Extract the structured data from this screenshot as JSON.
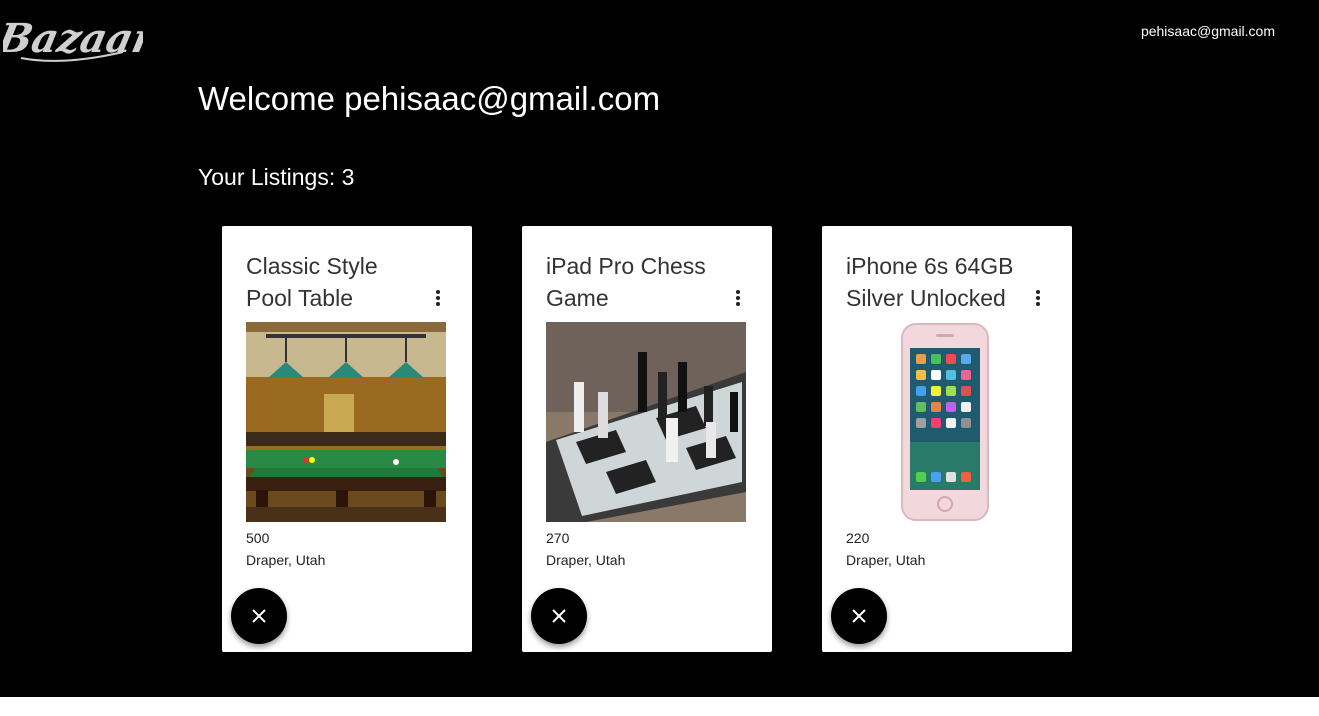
{
  "header": {
    "logo_text": "Bazaar!",
    "user_email": "pehisaac@gmail.com"
  },
  "main": {
    "welcome_text": "Welcome pehisaac@gmail.com",
    "listings_label": "Your Listings: 3"
  },
  "listings": [
    {
      "title": "Classic Style Pool Table",
      "price": "500",
      "location": "Draper, Utah",
      "image": "pool-table-photo"
    },
    {
      "title": "iPad Pro Chess Game",
      "price": "270",
      "location": "Draper, Utah",
      "image": "chess-ipad-photo"
    },
    {
      "title": "iPhone 6s 64GB Silver Unlocked",
      "price": "220",
      "location": "Draper, Utah",
      "image": "iphone-photo"
    }
  ],
  "icons": {
    "menu": "more-vert-icon",
    "delete": "close-icon"
  },
  "colors": {
    "background": "#000000",
    "card": "#ffffff",
    "delete_button": "#000000"
  }
}
